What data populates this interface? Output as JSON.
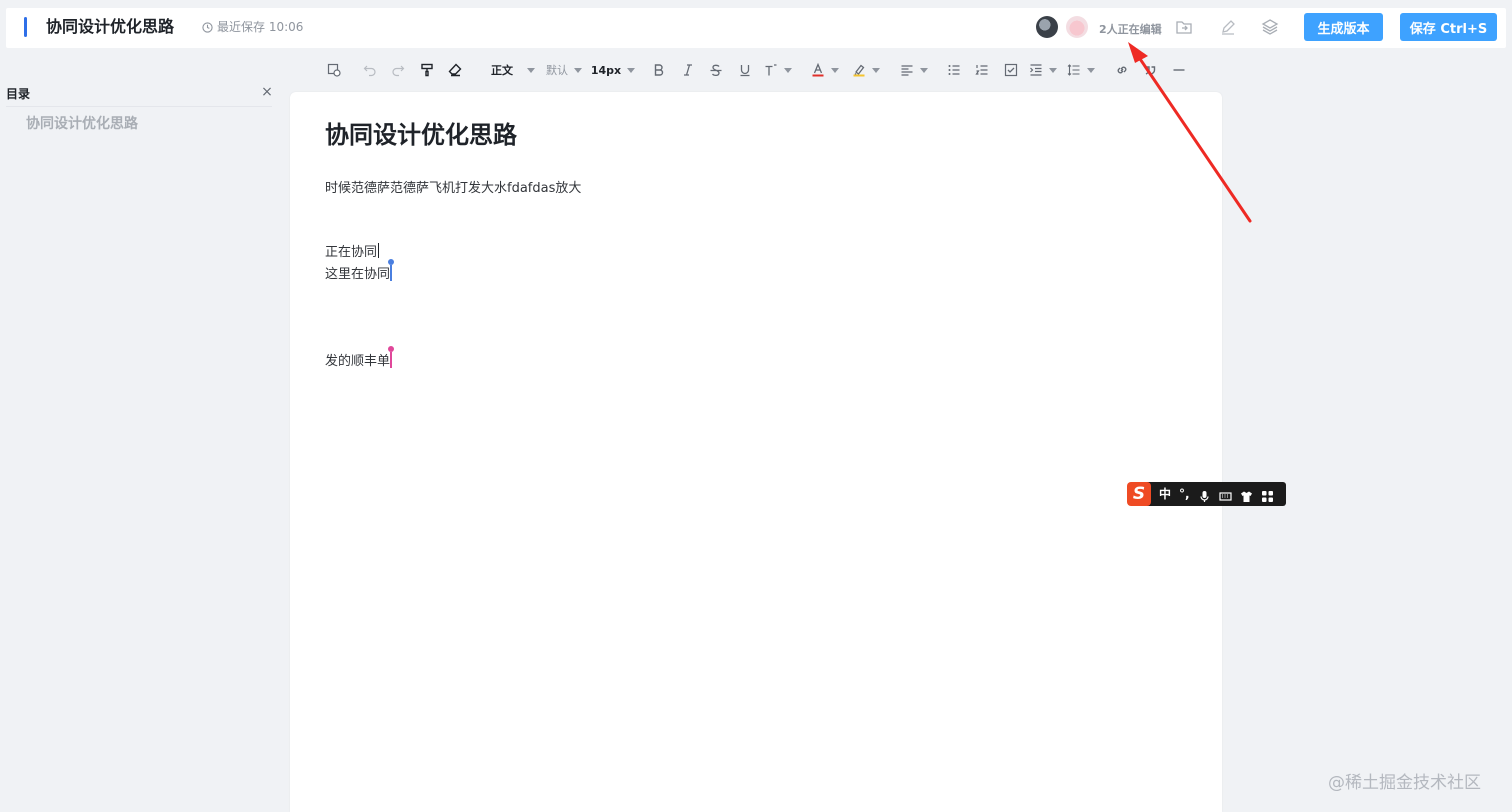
{
  "header": {
    "doc_title": "协同设计优化思路",
    "save_status": "最近保存 10:06",
    "editing_count": "2人正在编辑",
    "buttons": {
      "generate_version": "生成版本",
      "save": "保存 Ctrl+S"
    },
    "icons": [
      "move-to-folder-icon",
      "edit-icon",
      "layers-icon"
    ],
    "accent_color": "#2f6fe8",
    "button_color": "#3ea2ff"
  },
  "toolbar": {
    "paragraph_style": "正文",
    "font_family": "默认",
    "font_size": "14px",
    "icons": [
      "insert-template-icon",
      "undo-icon",
      "redo-icon",
      "format-painter-icon",
      "clear-format-icon",
      "bold-icon",
      "italic-icon",
      "strikethrough-icon",
      "underline-icon",
      "superscript-icon",
      "font-color-icon",
      "highlight-icon",
      "align-icon",
      "bullet-list-icon",
      "ordered-list-icon",
      "todo-list-icon",
      "indent-icon",
      "line-height-icon",
      "link-icon",
      "quote-icon",
      "divider-icon"
    ]
  },
  "toc": {
    "title": "目录",
    "close": "×",
    "items": [
      {
        "label": "协同设计优化思路"
      }
    ]
  },
  "document": {
    "heading": "协同设计优化思路",
    "paragraphs": [
      "时候范德萨范德萨飞机打发大水fdafdas放大",
      "正在协同",
      "这里在协同",
      "发的顺丰单"
    ],
    "remote_cursor_colors": [
      "#4a7fe0",
      "#e0479a"
    ]
  },
  "ime_bar": {
    "logo": "S",
    "mode": "中",
    "punct": "°,",
    "icons": [
      "microphone-icon",
      "keyboard-icon",
      "skin-icon",
      "grid-icon"
    ]
  },
  "annotation": {
    "arrow_color": "#ee2a24"
  },
  "watermark": "@稀土掘金技术社区"
}
